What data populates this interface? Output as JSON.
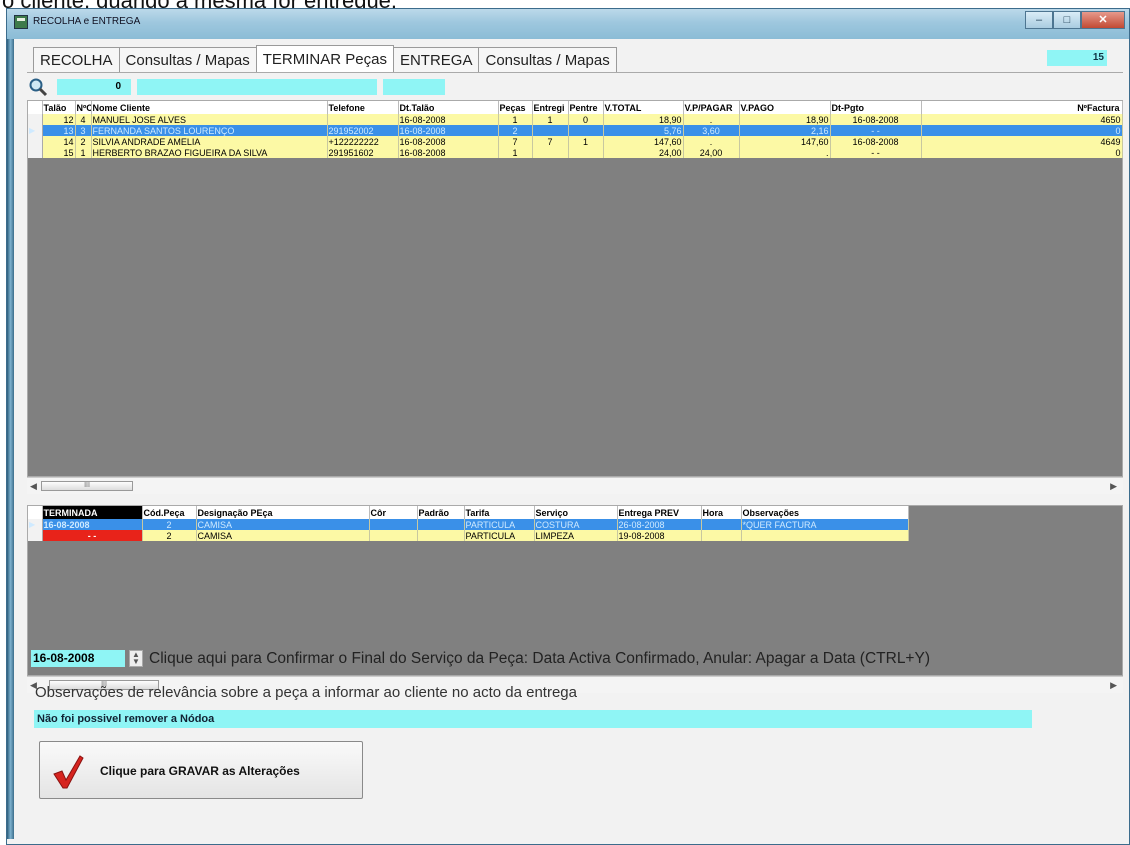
{
  "page_top_text": "o cliente, quando a mesma for entregue.",
  "window": {
    "title": "RECOLHA e ENTREGA",
    "minimize": "–",
    "maximize": "□",
    "close": "✕"
  },
  "tabs": [
    {
      "label": "RECOLHA"
    },
    {
      "label": "Consultas / Mapas"
    },
    {
      "label": "TERMINAR Peças"
    },
    {
      "label": "ENTREGA"
    },
    {
      "label": "Consultas / Mapas"
    }
  ],
  "tab_counter": "15",
  "search": {
    "count": "0",
    "icon": "search-icon"
  },
  "grid1": {
    "columns": [
      "Talão",
      "NºCli",
      "Nome Cliente",
      "Telefone",
      "Dt.Talão",
      "Peças",
      "Entregi",
      "Pentre",
      "V.TOTAL",
      "V.P/PAGAR",
      "V.PAGO",
      "Dt-Pgto",
      "NºFactura"
    ],
    "rows": [
      {
        "talao": "12",
        "cli": "4",
        "nome": "MANUEL JOSE ALVES",
        "tel": "",
        "dt": "16-08-2008",
        "pecas": "1",
        "entr": "1",
        "pentr": "0",
        "total": "18,90",
        "ppagar": ".",
        "pago": "18,90",
        "dtpgto": "16-08-2008",
        "fact": "4650",
        "style": "yellow",
        "indicator": ""
      },
      {
        "talao": "13",
        "cli": "3",
        "nome": "FERNANDA SANTOS LOURENÇO",
        "tel": "291952002",
        "dt": "16-08-2008",
        "pecas": "2",
        "entr": "",
        "pentr": "",
        "total": "5,76",
        "ppagar": "3,60",
        "pago": "2,16",
        "dtpgto": "- -",
        "fact": "0",
        "style": "blue",
        "indicator": "▶"
      },
      {
        "talao": "14",
        "cli": "2",
        "nome": "SILVIA ANDRADE AMELIA",
        "tel": "+122222222",
        "dt": "16-08-2008",
        "pecas": "7",
        "entr": "7",
        "pentr": "1",
        "total": "147,60",
        "ppagar": ".",
        "pago": "147,60",
        "dtpgto": "16-08-2008",
        "fact": "4649",
        "style": "yellow",
        "indicator": ""
      },
      {
        "talao": "15",
        "cli": "1",
        "nome": "HERBERTO BRAZAO FIGUEIRA DA SILVA",
        "tel": "291951602",
        "dt": "16-08-2008",
        "pecas": "1",
        "entr": "",
        "pentr": "",
        "total": "24,00",
        "ppagar": "24,00",
        "pago": ".",
        "dtpgto": "- -",
        "fact": "0",
        "style": "yellow",
        "indicator": ""
      }
    ]
  },
  "grid2": {
    "columns": [
      "TERMINADA",
      "Cód.Peça",
      "Designação PEça",
      "Côr",
      "Padrão",
      "Tarifa",
      "Serviço",
      "Entrega PREV",
      "Hora",
      "Observações"
    ],
    "rows": [
      {
        "term": "16-08-2008",
        "cod": "2",
        "desig": "CAMISA",
        "cor": "",
        "padrao": "",
        "tarifa": "PARTICULA",
        "servico": "COSTURA",
        "prev": "26-08-2008",
        "hora": "",
        "obs": "*QUER FACTURA",
        "style": "blue",
        "indicator": "▶"
      },
      {
        "term": "- -",
        "cod": "2",
        "desig": "CAMISA",
        "cor": "",
        "padrao": "",
        "tarifa": "PARTICULA",
        "servico": "LIMPEZA",
        "prev": "19-08-2008",
        "hora": "",
        "obs": "",
        "style": "yellow",
        "indicator": ""
      }
    ]
  },
  "scroll_thumb": "III",
  "footer": {
    "date": "16-08-2008",
    "confirm_text": "Clique aqui para Confirmar o Final do Serviço da Peça: Data Activa Confirmado, Anular: Apagar a Data (CTRL+Y)",
    "obs_label": "Observações de relevância sobre a peça a informar ao cliente no acto da entrega",
    "obs_value": "Não foi possivel remover a Nódoa",
    "save_label": "Clique para GRAVAR as Alterações"
  },
  "colors": {
    "cyan": "#8ff5f5",
    "row_yellow": "#fcf9a5",
    "row_blue": "#3a90e8",
    "terminada_red": "#e8231a"
  }
}
